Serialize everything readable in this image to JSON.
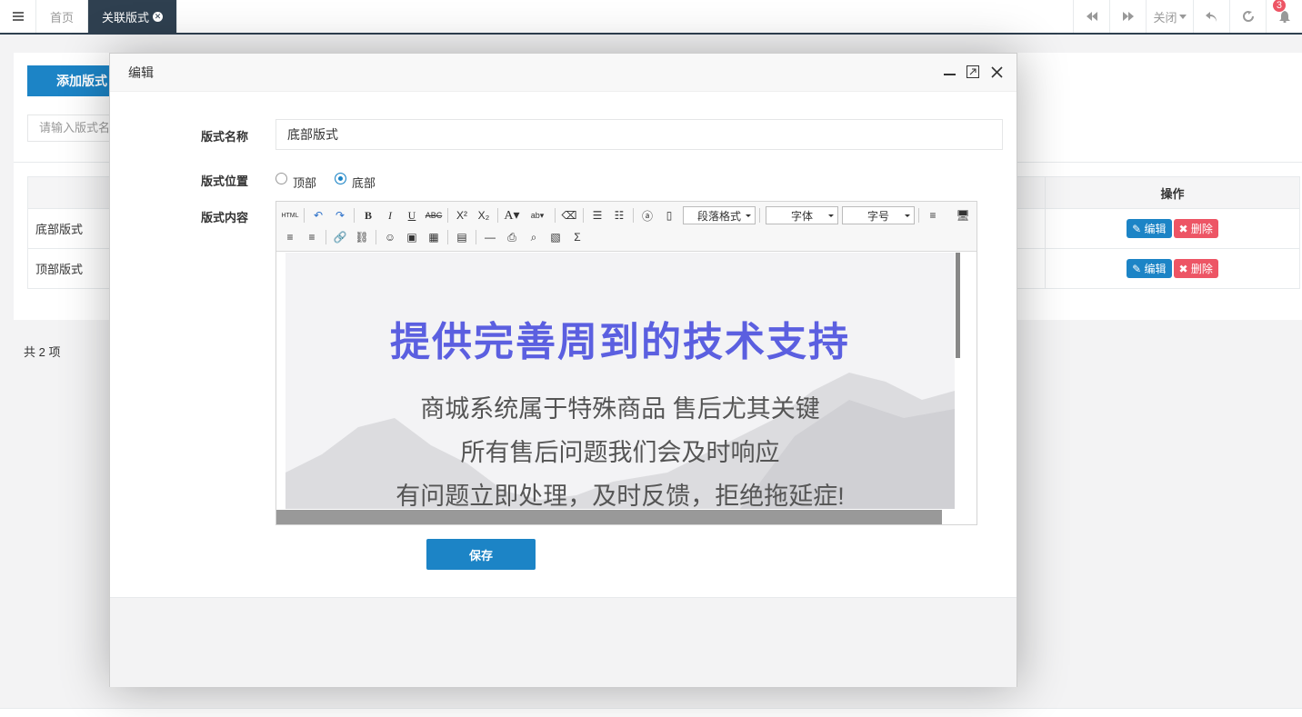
{
  "topbar": {
    "menu_icon": "hamburger-icon",
    "tabs": [
      {
        "label": "首页",
        "active": false
      },
      {
        "label": "关联版式",
        "active": true
      }
    ],
    "close_label": "关闭",
    "notification_count": "3"
  },
  "page": {
    "add_button": "添加版式",
    "search_placeholder": "请输入版式名",
    "table": {
      "ops_header": "操作",
      "rows": [
        {
          "name": "底部版式",
          "edit": "编辑",
          "delete": "删除"
        },
        {
          "name": "顶部版式",
          "edit": "编辑",
          "delete": "删除"
        }
      ]
    },
    "total": "共 2 项"
  },
  "modal": {
    "title": "编辑",
    "name_label": "版式名称",
    "name_value": "底部版式",
    "position_label": "版式位置",
    "position_options": [
      {
        "label": "顶部",
        "checked": false
      },
      {
        "label": "底部",
        "checked": true
      }
    ],
    "content_label": "版式内容",
    "editor": {
      "paragraph_format": "段落格式",
      "font_family": "字体",
      "font_size": "字号",
      "heading": "提供完善周到的技术支持",
      "lines": [
        "商城系统属于特殊商品 售后尤其关键",
        "所有售后问题我们会及时响应",
        "有问题立即处理，及时反馈，拒绝拖延症!"
      ],
      "heading_color": "#5b5fe0"
    },
    "save_button": "保存"
  },
  "colors": {
    "primary": "#1c84c6",
    "danger": "#ed5565",
    "nav_dark": "#2f4050"
  }
}
